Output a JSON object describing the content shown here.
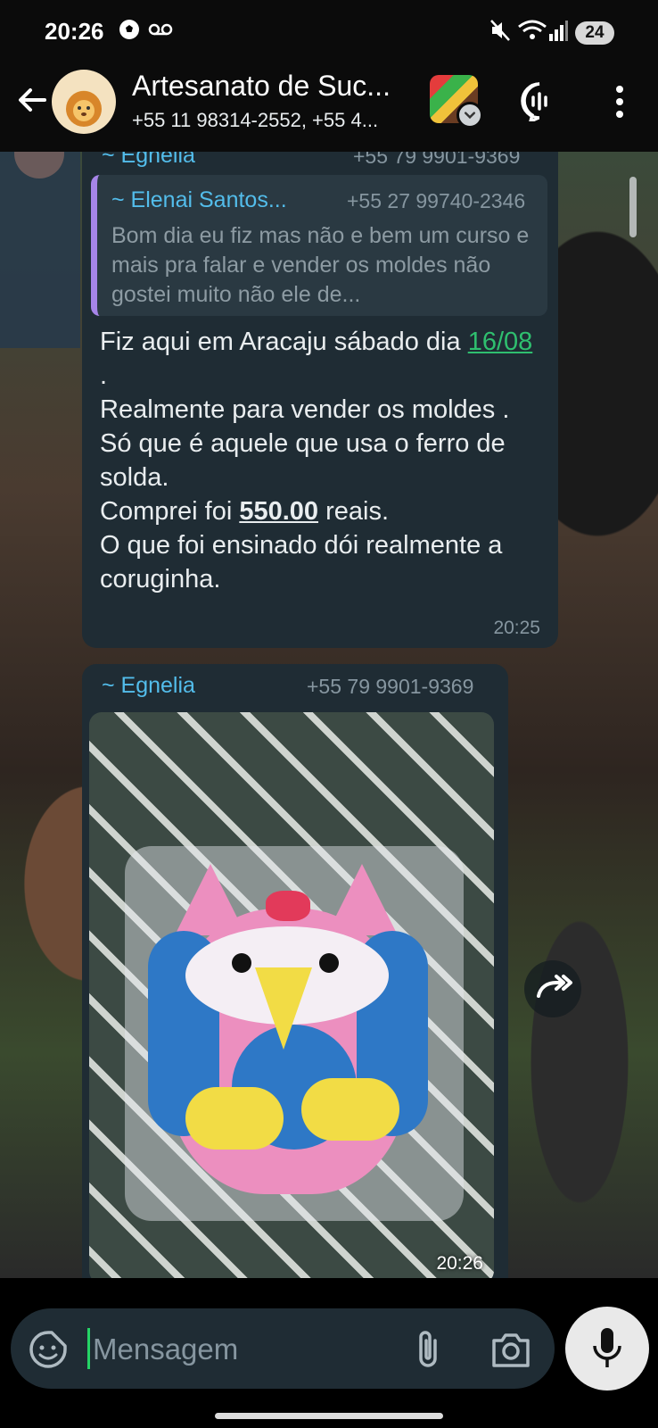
{
  "status_bar": {
    "time": "20:26",
    "battery": "24"
  },
  "header": {
    "title": "Artesanato de Suc...",
    "subtitle": "+55 11 98314-2552, +55 4..."
  },
  "messages": [
    {
      "sender": "~ Egnelia",
      "phone": "+55 79 9901-9369",
      "quote": {
        "sender": "~ Elenai Santos...",
        "phone": "+55 27 99740-2346",
        "text": "Bom dia eu fiz mas não e bem um curso e mais pra falar e vender os moldes não gostei muito não ele de..."
      },
      "text_parts": {
        "line1": "Fiz aqui em Aracaju sábado dia ",
        "date": "16/08",
        "line1_end": " .",
        "line2": "Realmente para vender os moldes .",
        "line3": "Só que é aquele que usa o ferro de solda.",
        "line4_start": "Comprei foi ",
        "amount": "550.00",
        "line4_end": " reais.",
        "line5": "O que foi ensinado dói realmente a coruginha."
      },
      "time": "20:25"
    },
    {
      "sender": "~ Egnelia",
      "phone": "+55 79 9901-9369",
      "time": "20:26"
    }
  ],
  "input": {
    "placeholder": "Mensagem"
  },
  "colors": {
    "bubble": "#1f2c34",
    "sender": "#53bdeb",
    "link": "#2fbf6f",
    "quote_bar": "#a685e8"
  }
}
